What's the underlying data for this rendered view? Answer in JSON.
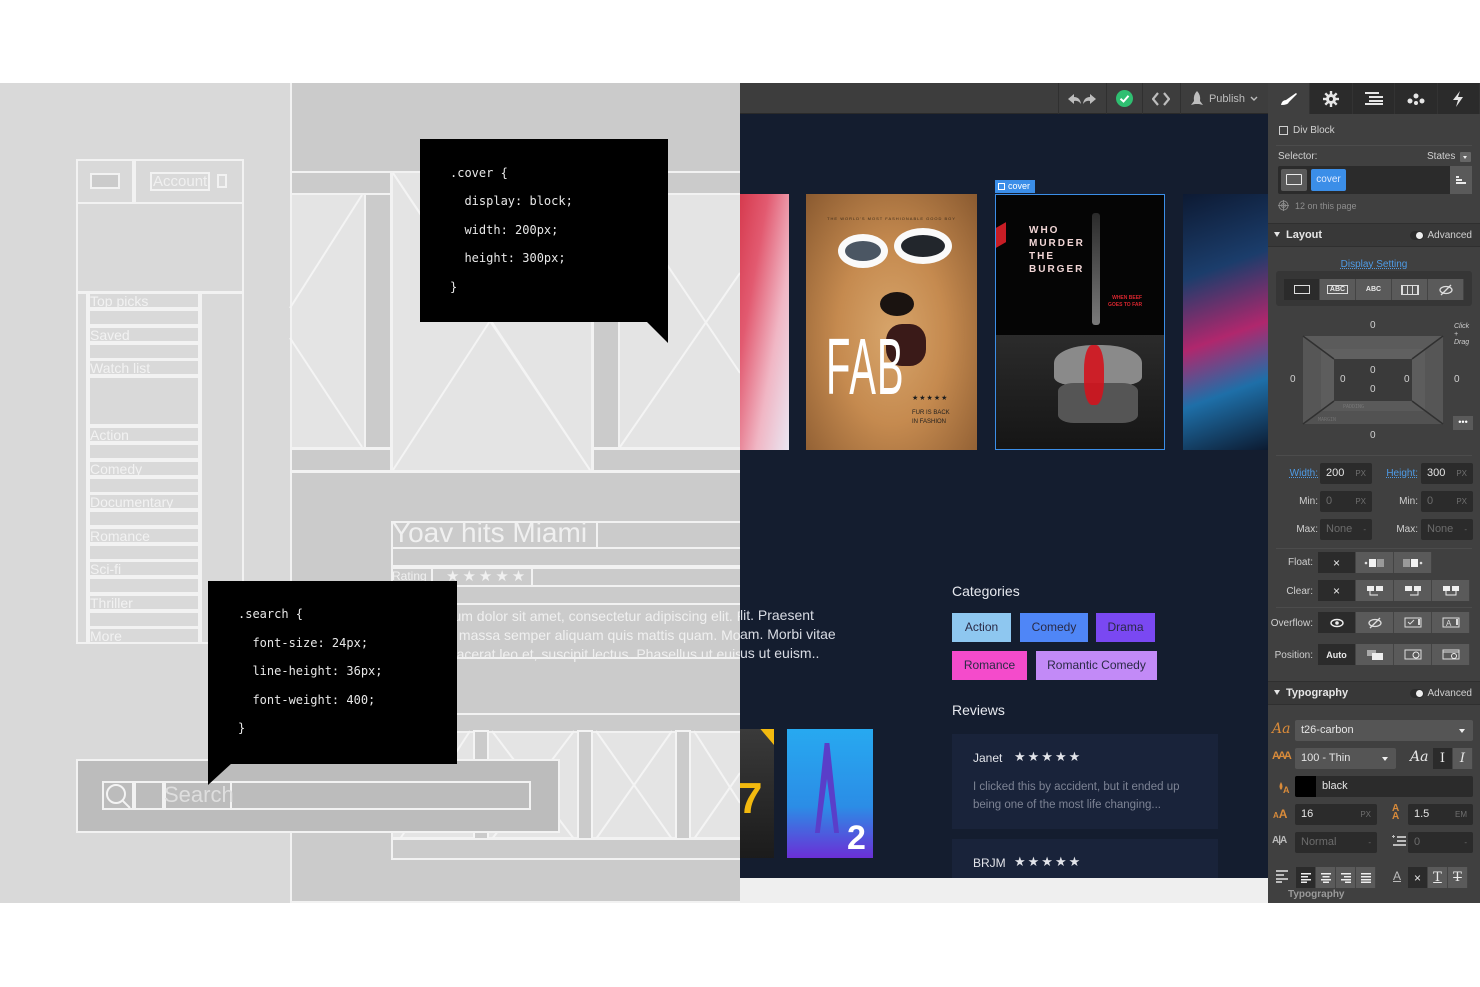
{
  "wireframe": {
    "account_label": "Account",
    "nav_items": [
      "Top picks",
      "Saved",
      "Watch list",
      "Action",
      "Comedy",
      "Documentary",
      "Romance",
      "Sci-fi",
      "Thriller",
      "More"
    ],
    "headline": "Yoav hits Miami",
    "rating_label": "Rating",
    "rating_stars": "★★★★★",
    "lorem": [
      "Lorem ipsum dolor sit amet, consectetur adipiscing elit. Praesent",
      "Nam vitae massa semper aliquam quis mattis quam. Morbi vitae",
      "tempus, placerat leo et, suscipit lectus. Phasellus ut euism.."
    ],
    "search_placeholder": "Search",
    "cover_css": [
      ".cover {",
      "  display: block;",
      "  width: 200px;",
      "  height: 300px;",
      "}"
    ],
    "search_css": [
      ".search {",
      "  font-size: 24px;",
      "  line-height: 36px;",
      "  font-weight: 400;",
      "}"
    ]
  },
  "canvas": {
    "toolbar": {
      "undo_icon": "undo-icon",
      "redo_icon": "redo-icon",
      "status_icon": "check-circle-icon",
      "code_icon": "code-icon",
      "publish_label": "Publish"
    },
    "selected_tag": "cover",
    "posters": [
      {
        "name": "red-streak-poster"
      },
      {
        "name": "fab-poster",
        "tagline": "THE WORLD'S MOST FASHIONABLE GOOD BOY",
        "title": "FAB",
        "stars": "★★★★★",
        "subtitle_1": "FUR IS BACK",
        "subtitle_2": "IN FASHION"
      },
      {
        "name": "who-murder-the-burger-poster",
        "title_lines": [
          "WHO",
          "MURDER",
          "THE",
          "BURGER"
        ],
        "side": "WHEN BEEF",
        "side_2": "GOES TO FAR"
      },
      {
        "name": "neon-city-poster"
      }
    ],
    "lorem_visible": [
      "lit. Praesent",
      "am. Morbi vitae",
      "us ut euism.."
    ],
    "categories_title": "Categories",
    "categories": [
      {
        "label": "Action",
        "color": "#8ec7f0"
      },
      {
        "label": "Comedy",
        "color": "#4f86f7"
      },
      {
        "label": "Drama",
        "color": "#7a48f2"
      },
      {
        "label": "Romance",
        "color": "#f44bcb"
      },
      {
        "label": "Romantic Comedy",
        "color": "#c28af7"
      }
    ],
    "reviews_title": "Reviews",
    "reviews": [
      {
        "name": "Janet",
        "stars": "★★★★★",
        "text": "I clicked this by accident, but it ended up being one of the most life changing..."
      },
      {
        "name": "BRJM",
        "stars": "★★★★★",
        "text": ""
      }
    ],
    "bottom_posters": [
      {
        "name": "seven-poster",
        "label": "7"
      },
      {
        "name": "blue-two-poster",
        "label": "2"
      }
    ]
  },
  "panel": {
    "tabs": [
      "brush-icon",
      "gear-icon",
      "navigator-icon",
      "interactions-icon",
      "lightning-icon"
    ],
    "element_type": "Div Block",
    "selector_label": "Selector:",
    "states_label": "States",
    "selector_chip": "cover",
    "usage": "12 on this page",
    "layout": {
      "title": "Layout",
      "advanced": "Advanced",
      "display_setting": "Display Setting",
      "display_options": [
        "block",
        "inline-block",
        "inline",
        "flex",
        "none"
      ],
      "display_labels": [
        "",
        "ABC",
        "ABC",
        "",
        ""
      ],
      "click_drag": "Click + Drag",
      "margin_top": "0",
      "margin_right": "0",
      "margin_bottom": "0",
      "margin_left": "0",
      "padding_top": "0",
      "padding_right": "0",
      "padding_bottom": "0",
      "padding_left": "0",
      "padding_label": "PADDING",
      "margin_label": "MARGIN",
      "width_label": "Width:",
      "width_value": "200",
      "width_unit": "PX",
      "height_label": "Height:",
      "height_value": "300",
      "height_unit": "PX",
      "min_label": "Min:",
      "min_w": "0",
      "min_h": "0",
      "min_unit": "PX",
      "max_label": "Max:",
      "max_w": "None",
      "max_h": "None",
      "max_unit": "-",
      "float_label": "Float:",
      "clear_label": "Clear:",
      "overflow_label": "Overflow:",
      "position_label": "Position:",
      "position_value": "Auto",
      "none_glyph": "×"
    },
    "typography": {
      "title": "Typography",
      "advanced": "Advanced",
      "font": "t26-carbon",
      "weight": "100 - Thin",
      "color_name": "black",
      "color_value": "#000000",
      "size": "16",
      "size_unit": "PX",
      "line_height": "1.5",
      "line_height_unit": "EM",
      "letter_spacing": "Normal",
      "letter_unit": "-",
      "indent": "0",
      "indent_unit": "-",
      "style_glyph": "Aa",
      "font_icon": "Aa",
      "decoration_none": "×"
    },
    "footer_label": "Typography"
  }
}
